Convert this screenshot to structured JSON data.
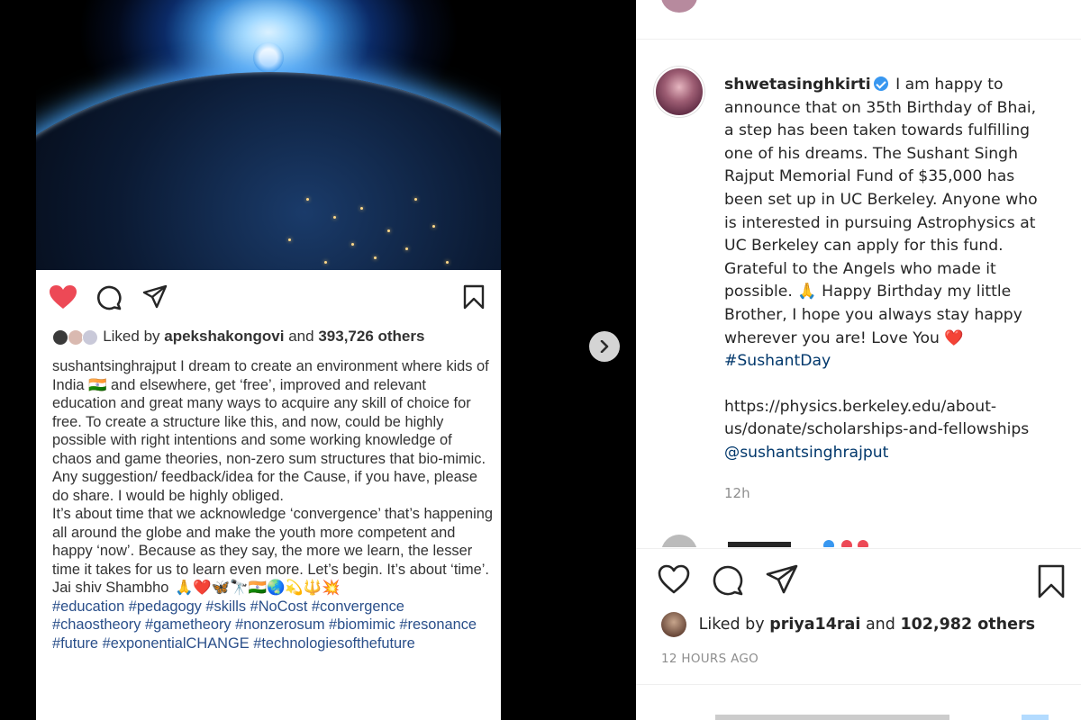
{
  "colors": {
    "like_red": "#ed4956",
    "link_blue": "#00376b",
    "hashtag_blue": "#2a4f8a",
    "verified_blue": "#3897f0",
    "muted_gray": "#8e8e8e",
    "text_dark": "#262626"
  },
  "media_post": {
    "likes": {
      "prefix": "Liked by",
      "user": "apekshakongovi",
      "conjunction": "and",
      "count": "393,726 others"
    },
    "caption": {
      "username": "sushantsinghrajput",
      "paragraph1": " I dream to create an environment where kids of India 🇮🇳 and elsewhere, get ‘free’, improved and relevant education and great many ways to acquire any skill of choice for free. To create a structure like this, and now, could be highly possible with right intentions and some working knowledge of chaos and game theories, non-zero sum structures that bio-mimic. Any suggestion/ feedback/idea for the Cause, if you have, please do share. I would be highly obliged.",
      "paragraph2": "It’s about time that we acknowledge ‘convergence’ that’s happening all around the globe and make the youth more competent and happy ‘now’. Because as they say, the more we learn, the lesser time it takes for us to learn even more. Let’s begin. It’s about ‘time’.",
      "closing": "Jai shiv Shambho",
      "closing_emojis": "🙏❤️🦋🔭🇮🇳🌏💫🔱💥",
      "hashtags": "#education #pedagogy #skills #NoCost #convergence #chaostheory #gametheory #nonzerosum #biomimic #resonance #future #exponentialCHANGE #technologiesofthefuture"
    },
    "icons": {
      "like": "heart-filled-icon",
      "comment": "comment-bubble-icon",
      "share": "paper-plane-icon",
      "save": "bookmark-icon"
    }
  },
  "carousel": {
    "next_icon": "chevron-right-icon"
  },
  "panel": {
    "author": {
      "username": "shwetasinghkirti",
      "verified": true
    },
    "caption_text": " I am happy to announce that on 35th Birthday of Bhai, a step has been taken towards fulfilling one of his dreams. The Sushant Singh Rajput Memorial Fund of $35,000 has been set up in UC Berkeley. Anyone who is interested in pursuing Astrophysics at UC Berkeley can apply for this fund. Grateful to the Angels who made it possible. 🙏 Happy Birthday my little Brother, I hope you always stay happy wherever you are! Love You ",
    "heart_emoji": "❤️",
    "hashtag": "#SushantDay",
    "url": "https://physics.berkeley.edu/about-us/donate/scholarships-and-fellowships ",
    "mention": "@sushantsinghrajput",
    "time_short": "12h",
    "likes": {
      "prefix": "Liked by",
      "user": "priya14rai",
      "conjunction": "and",
      "count": "102,982 others"
    },
    "time_long": "12 HOURS AGO",
    "icons": {
      "like": "heart-outline-icon",
      "comment": "comment-bubble-icon",
      "share": "paper-plane-icon",
      "save": "bookmark-icon"
    }
  }
}
